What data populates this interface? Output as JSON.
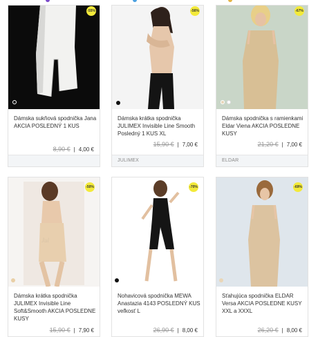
{
  "colors": {
    "badge": "#f3ea3a",
    "card_border": "#e2e2e2",
    "brand_bar": "#f3f5f7"
  },
  "products": [
    {
      "name": "Dámska sukňová spodnička Jana AKCIA POSLEDNÝ 1 KUS",
      "badge": "-55%",
      "old_price": "8,90 €",
      "price": "4,00 €",
      "brand": "",
      "swatches": [
        "#ffffff"
      ]
    },
    {
      "name": "Dámska krátka spodnička JULIMEX Invisible Line Smooth Posledný 1 KUS XL",
      "badge": "-56%",
      "old_price": "15,90 €",
      "price": "7,00 €",
      "brand": "JULIMEX",
      "swatches": [
        "#111111"
      ]
    },
    {
      "name": "Dámska spodnička s ramienkami Eldar Viena AKCIA POSLEDNE KUSY",
      "badge": "-67%",
      "old_price": "21,20 €",
      "price": "7,00 €",
      "brand": "ELDAR",
      "swatches": [
        "#e9d6b8",
        "#ffffff"
      ]
    },
    {
      "name": "Dámska krátka spodnička JULIMEX Invisible Line Soft&Smooth AKCIA POSLEDNE KUSY",
      "badge": "-50%",
      "old_price": "15,90 €",
      "price": "7,90 €",
      "brand": "",
      "swatches": [
        "#e9cfa6"
      ]
    },
    {
      "name": "Nohavicová spodnička MEWA Anastazia 4143 POSLEDNÝ KUS veľkosť L",
      "badge": "-70%",
      "old_price": "26,90 €",
      "price": "8,00 €",
      "brand": "",
      "swatches": [
        "#111111"
      ]
    },
    {
      "name": "Sťahujúca spodnička ELDAR Versa AKCIA POSLEDNE KUSY XXL a XXXL",
      "badge": "-69%",
      "old_price": "26,20 €",
      "price": "8,00 €",
      "brand": "",
      "swatches": [
        "#e9d6b8"
      ]
    }
  ]
}
